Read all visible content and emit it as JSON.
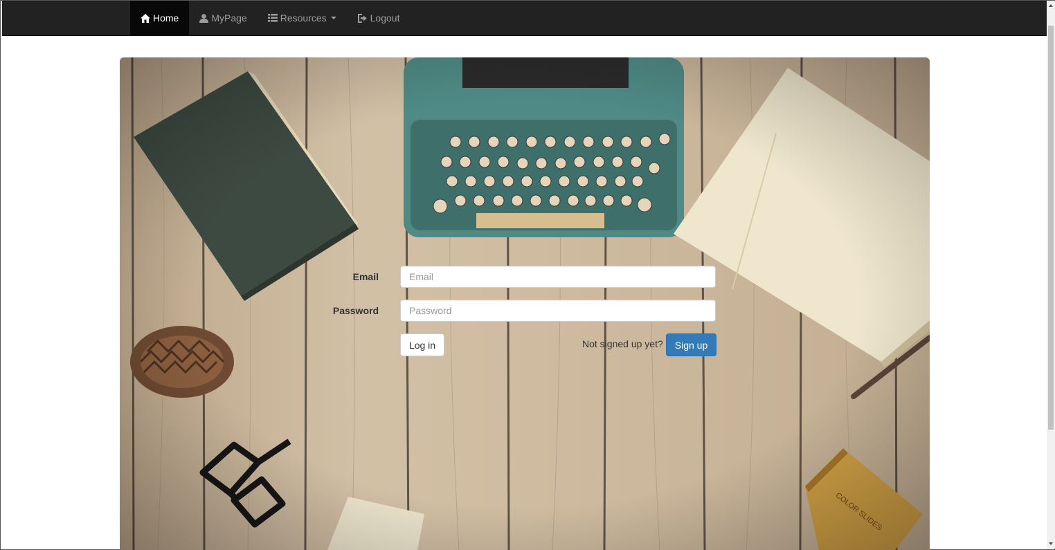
{
  "nav": {
    "items": [
      {
        "label": "Home",
        "icon": "home-icon",
        "active": true
      },
      {
        "label": "MyPage",
        "icon": "user-icon",
        "active": false
      },
      {
        "label": "Resources",
        "icon": "list-icon",
        "active": false,
        "has_dropdown": true
      },
      {
        "label": "Logout",
        "icon": "logout-icon",
        "active": false
      }
    ]
  },
  "login_form": {
    "email_label": "Email",
    "email_placeholder": "Email",
    "email_value": "",
    "password_label": "Password",
    "password_placeholder": "Password",
    "password_value": "",
    "login_button": "Log in",
    "signup_prompt": "Not signed up yet?",
    "signup_button": "Sign up"
  },
  "hero": {
    "box_label": "COLOR SLIDES"
  },
  "colors": {
    "navbar_bg": "#222222",
    "nav_active_bg": "#080808",
    "nav_text": "#9d9d9d",
    "primary": "#337ab7",
    "wood": "#c7b49a"
  }
}
